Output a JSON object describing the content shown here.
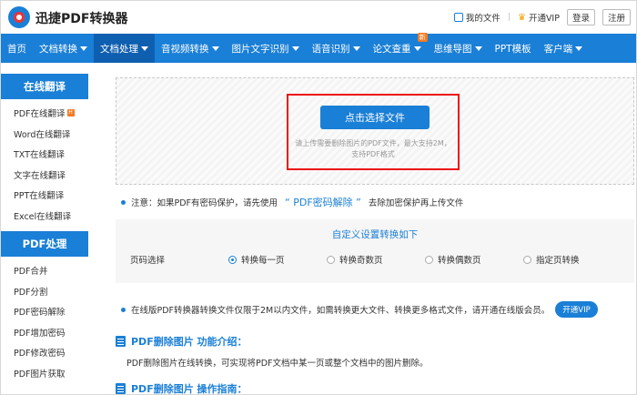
{
  "header": {
    "brand": "迅捷PDF转换器",
    "my_files": "我的文件",
    "vip": "开通VIP",
    "login": "登录",
    "register": "注册",
    "separator": "|"
  },
  "nav": {
    "items": [
      {
        "label": "首页",
        "caret": false
      },
      {
        "label": "文档转换",
        "caret": true
      },
      {
        "label": "文档处理",
        "caret": true,
        "active": true
      },
      {
        "label": "音视频转换",
        "caret": true
      },
      {
        "label": "图片文字识别",
        "caret": true
      },
      {
        "label": "语音识别",
        "caret": true
      },
      {
        "label": "论文查重",
        "caret": true,
        "badge": "新"
      },
      {
        "label": "思维导图",
        "caret": true
      },
      {
        "label": "PPT模板",
        "caret": false
      },
      {
        "label": "客户端",
        "caret": true
      }
    ]
  },
  "sidebar": {
    "sections": [
      {
        "title": "在线翻译",
        "items": [
          "PDF在线翻译",
          "Word在线翻译",
          "TXT在线翻译",
          "文字在线翻译",
          "PPT在线翻译",
          "Excel在线翻译"
        ]
      },
      {
        "title": "PDF处理",
        "items": [
          "PDF合并",
          "PDF分割",
          "PDF密码解除",
          "PDF增加密码",
          "PDF修改密码",
          "PDF图片获取"
        ]
      }
    ]
  },
  "upload": {
    "button": "点击选择文件",
    "hint_line1": "请上传需要删除图片的PDF文件，最大支持2M，",
    "hint_line2": "支持PDF格式"
  },
  "notice": {
    "prefix": "注意：如果PDF有密码保护，请先使用",
    "link": "“ PDF密码解除 ”",
    "suffix": "去除加密保护再上传文件"
  },
  "settings": {
    "title": "自定义设置转换如下",
    "label": "页码选择",
    "options": [
      {
        "label": "转换每一页",
        "checked": true
      },
      {
        "label": "转换奇数页",
        "checked": false
      },
      {
        "label": "转换偶数页",
        "checked": false
      },
      {
        "label": "指定页转换",
        "checked": false
      }
    ]
  },
  "vip_notice": {
    "text": "在线版PDF转换器转换文件仅限于2M以内文件，如需转换更大文件、转换更多格式文件，请开通在线版会员。",
    "button": "开通VIP"
  },
  "intro": {
    "title": "PDF删除图片 功能介绍：",
    "text": "PDF删除图片在线转换，可实现将PDF文档中某一页或整个文档中的图片删除。"
  },
  "guide": {
    "title": "PDF删除图片 操作指南："
  },
  "colors": {
    "primary": "#1a7fd6",
    "nav_active": "#0f5fb0",
    "highlight_border": "#e11111",
    "badge": "#f47a20"
  }
}
